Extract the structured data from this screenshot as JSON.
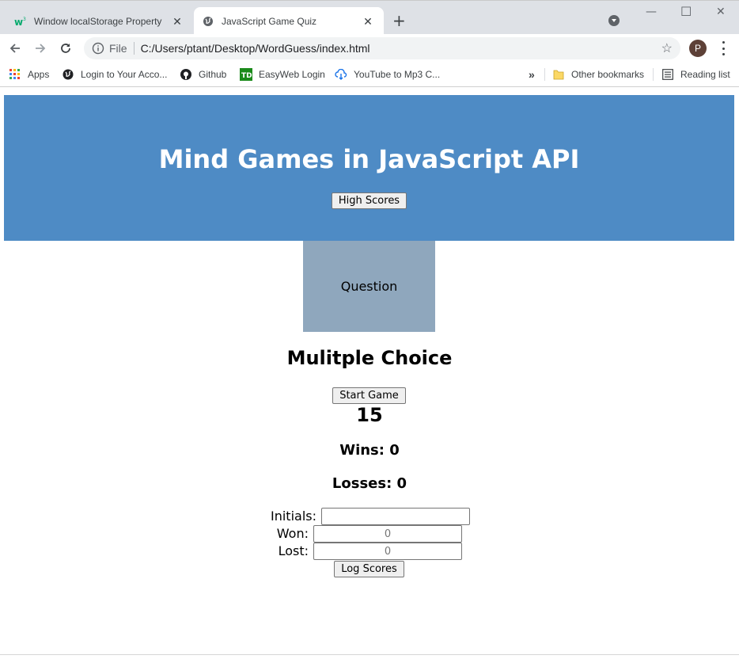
{
  "browser": {
    "tabs": [
      {
        "title": "Window localStorage Property",
        "active": false,
        "icon": "w3schools-icon"
      },
      {
        "title": "JavaScript Game Quiz",
        "active": true,
        "icon": "globe-icon"
      }
    ],
    "address": {
      "scheme": "File",
      "url": "C:/Users/ptant/Desktop/WordGuess/index.html"
    },
    "profile_initial": "P",
    "bookmarks": [
      {
        "label": "Apps",
        "icon": "apps-grid-icon"
      },
      {
        "label": "Login to Your Acco...",
        "icon": "globe-icon"
      },
      {
        "label": "Github",
        "icon": "github-icon"
      },
      {
        "label": "EasyWeb Login",
        "icon": "td-bank-icon"
      },
      {
        "label": "YouTube to Mp3 C...",
        "icon": "cloud-download-icon"
      }
    ],
    "bookmarks_overflow": "»",
    "other_bookmarks": "Other bookmarks",
    "reading_list": "Reading list"
  },
  "page": {
    "title": "Mind Games in JavaScript API",
    "high_scores_button": "High Scores",
    "question_box": "Question",
    "subtitle": "Mulitple Choice",
    "start_button": "Start Game",
    "timer": "15",
    "wins_text": "Wins: 0",
    "losses_text": "Losses: 0",
    "form": {
      "initials_label": "Initials:",
      "initials_value": "",
      "won_label": "Won:",
      "won_placeholder": "0",
      "lost_label": "Lost:",
      "lost_placeholder": "0",
      "submit_button": "Log Scores"
    }
  },
  "colors": {
    "header_bg": "#4e8bc5",
    "question_bg": "#8fa7bd"
  }
}
